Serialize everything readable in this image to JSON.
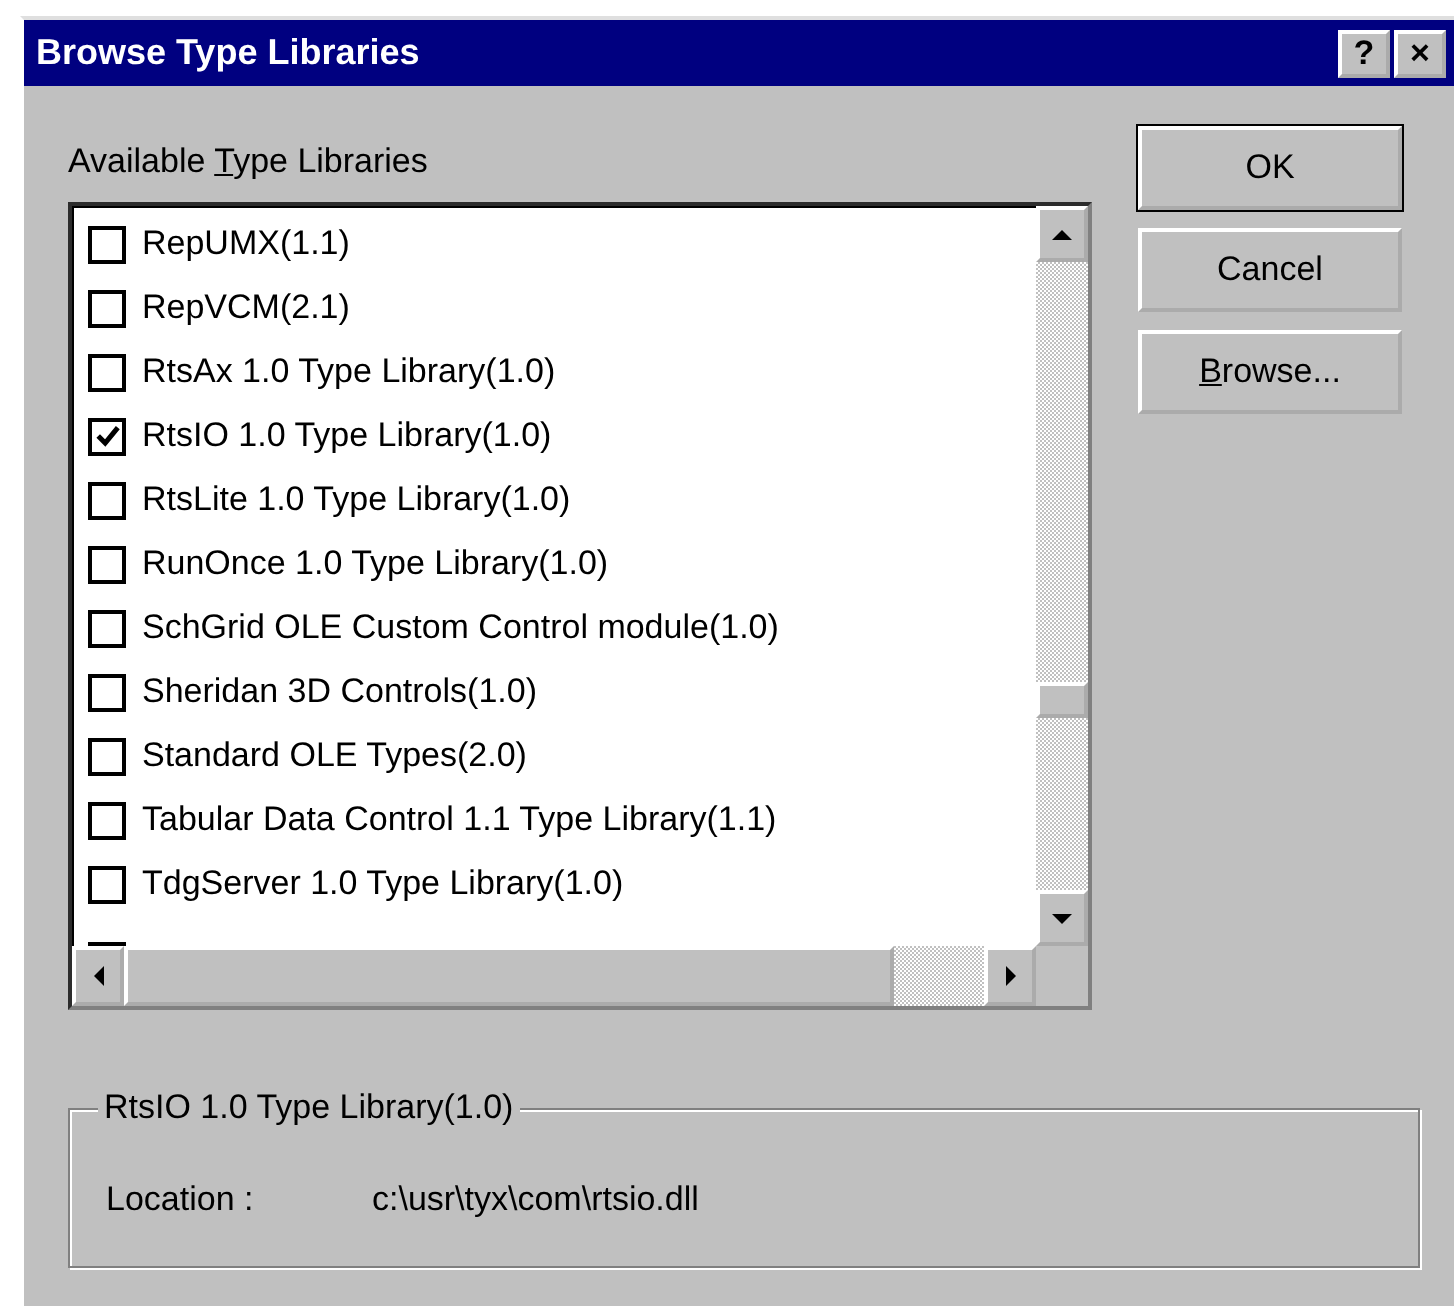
{
  "window": {
    "title": "Browse Type Libraries",
    "title_buttons": [
      "?",
      "×"
    ]
  },
  "list_label": {
    "before": "Available ",
    "mnemonic": "T",
    "after": "ype Libraries"
  },
  "libraries": [
    {
      "name": "RepUMX(1.1)",
      "checked": false
    },
    {
      "name": "RepVCM(2.1)",
      "checked": false
    },
    {
      "name": "RtsAx 1.0 Type Library(1.0)",
      "checked": false
    },
    {
      "name": "RtsIO 1.0 Type Library(1.0)",
      "checked": true
    },
    {
      "name": "RtsLite 1.0 Type Library(1.0)",
      "checked": false
    },
    {
      "name": "RunOnce 1.0 Type Library(1.0)",
      "checked": false
    },
    {
      "name": "SchGrid OLE Custom Control module(1.0)",
      "checked": false
    },
    {
      "name": "Sheridan 3D Controls(1.0)",
      "checked": false
    },
    {
      "name": "Standard OLE Types(2.0)",
      "checked": false
    },
    {
      "name": "Tabular Data Control 1.1 Type Library(1.1)",
      "checked": false
    },
    {
      "name": "TdgServer 1.0 Type Library(1.0)",
      "checked": false
    }
  ],
  "buttons": [
    {
      "after": "OK",
      "default": true
    },
    {
      "after": "Cancel",
      "default": false
    },
    {
      "mnemonic": "B",
      "after": "rowse...",
      "default": false
    }
  ],
  "details": {
    "title": "RtsIO 1.0 Type Library(1.0)",
    "location_label": "Location :",
    "location": "c:\\usr\\tyx\\com\\rtsio.dll"
  }
}
